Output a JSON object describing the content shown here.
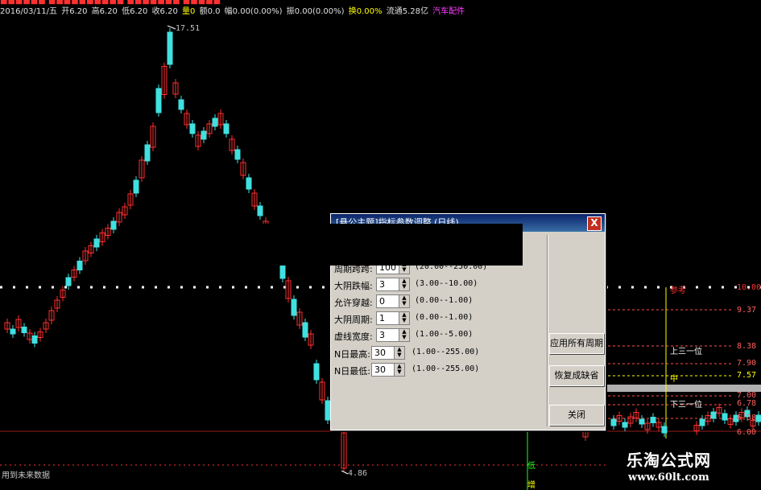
{
  "header": {
    "line1": "■■■■■■ ■■■■■■■■■■ ■■■■■■■ ■■■■■",
    "date": "2016/03/11/五",
    "open": "开6.20",
    "high": "高6.20",
    "low": "低6.20",
    "close": "收6.20",
    "volume": "量0",
    "amount": "额0.0",
    "amplitude": "幅0.00(0.00%)",
    "swing": "振0.00(0.00%)",
    "turnover": "换0.00%",
    "float": "流通5.28亿",
    "sector": "汽车配件"
  },
  "price_labels": {
    "high_peak": "17.51",
    "low_bottom": "4.86"
  },
  "right_labels": {
    "ref_label": "参考",
    "upper_third": "上三一位",
    "middle": "中",
    "lower_third": "下三一位",
    "low": "低",
    "increase": "增",
    "p1000": "10.00",
    "p937": "9.37",
    "p838": "8.38",
    "p790": "7.90",
    "p757": "7.57",
    "p700": "7.00",
    "p678": "6.78",
    "p638": "6.38",
    "p600": "6.00"
  },
  "footer_note": "用到未来数据",
  "dialog": {
    "title": "[悬公主题]指标参数调整 (日线)",
    "close_label": "X",
    "params": [
      {
        "name": "周期跨跨:",
        "value": "100",
        "range": "(20.00--250.00)"
      },
      {
        "name": "大阴跌幅:",
        "value": "3",
        "range": "(3.00--10.00)"
      },
      {
        "name": "允许穿越:",
        "value": "0",
        "range": "(0.00--1.00)"
      },
      {
        "name": "大阴周期:",
        "value": "1",
        "range": "(0.00--1.00)"
      },
      {
        "name": "虚线宽度:",
        "value": "3",
        "range": "(1.00--5.00)"
      },
      {
        "name": "N日最高:",
        "value": "30",
        "range": "(1.00--255.00)"
      },
      {
        "name": "N日最低:",
        "value": "30",
        "range": "(1.00--255.00)"
      }
    ],
    "buttons": {
      "apply_all": "应用所有周期",
      "restore_default": "恢复成缺省",
      "close": "关闭"
    }
  },
  "watermark": {
    "brand": "乐淘公式网",
    "url": "www.60lt.com"
  },
  "colors": {
    "background": "#000000",
    "up_candle": "#ff3030",
    "down_candle": "#40e0e0",
    "dialog_face": "#d4d0c8",
    "title_bar": "#0a246a"
  }
}
